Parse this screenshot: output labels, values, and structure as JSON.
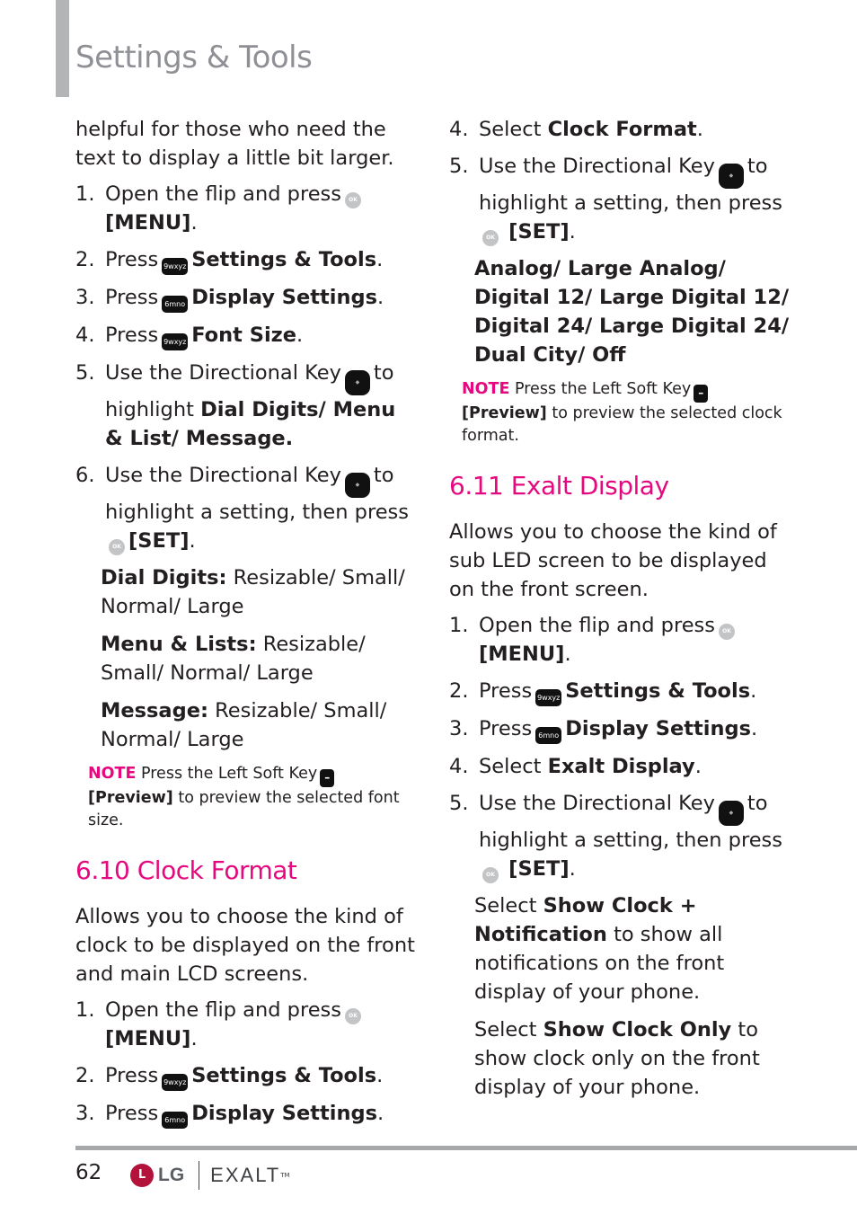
{
  "header": {
    "title": "Settings & Tools"
  },
  "left_column": {
    "intro": "helpful for those who need the text to display a little bit larger.",
    "steps": [
      {
        "num": "1.",
        "pre": "Open the flip and press",
        "icon": "ok-key",
        "icon_text": "OK",
        "bold": "[MENU]",
        "post": "."
      },
      {
        "num": "2.",
        "pre": "Press",
        "icon": "key-9",
        "icon_text": "9wxyz",
        "bold": "Settings & Tools",
        "post": "."
      },
      {
        "num": "3.",
        "pre": "Press",
        "icon": "key-6",
        "icon_text": "6mno",
        "bold": "Display Settings",
        "post": "."
      },
      {
        "num": "4.",
        "pre": "Press",
        "icon": "key-9",
        "icon_text": "9wxyz",
        "bold": "Font Size",
        "post": "."
      },
      {
        "num": "5.",
        "pre": "Use the Directional Key",
        "icon": "directional-key",
        "mid": "to highlight",
        "bold": "Dial Digits/ Menu & List/ Message."
      },
      {
        "num": "6.",
        "pre": "Use the Directional Key",
        "icon": "directional-key",
        "mid": "to highlight a setting, then press",
        "icon2_text": "OK",
        "bold": "[SET]",
        "post": "."
      }
    ],
    "options": [
      {
        "label": "Dial Digits:",
        "values": "Resizable/ Small/ Normal/ Large"
      },
      {
        "label": "Menu & Lists:",
        "values": "Resizable/ Small/ Normal/ Large"
      },
      {
        "label": "Message:",
        "values": "Resizable/ Small/ Normal/ Large"
      }
    ],
    "note": {
      "tag": "NOTE",
      "text1": "Press the Left Soft Key",
      "bold": "[Preview]",
      "text2": "to preview the selected font size."
    },
    "section": {
      "title": "6.10 Clock Format",
      "intro": "Allows you to choose the kind of clock to be displayed on the front and main LCD screens.",
      "steps": [
        {
          "num": "1.",
          "pre": "Open the flip and press",
          "icon_text": "OK",
          "bold": "[MENU]",
          "post": "."
        },
        {
          "num": "2.",
          "pre": "Press",
          "icon_text": "9wxyz",
          "bold": "Settings & Tools",
          "post": "."
        },
        {
          "num": "3.",
          "pre": "Press",
          "icon_text": "6mno",
          "bold": "Display Settings",
          "post": "."
        }
      ]
    }
  },
  "right_column": {
    "steps": [
      {
        "num": "4.",
        "pre": "Select",
        "bold": "Clock Format",
        "post": "."
      },
      {
        "num": "5.",
        "pre": "Use the Directional Key",
        "mid": "to highlight a setting, then press",
        "icon2_text": "OK",
        "bold": "[SET]",
        "post": "."
      }
    ],
    "options_text": "Analog/ Large Analog/ Digital 12/ Large Digital 12/ Digital 24/ Large Digital 24/ Dual City/ Off",
    "note": {
      "tag": "NOTE",
      "text1": "Press the Left Soft Key",
      "bold": "[Preview]",
      "text2": "to preview the selected clock format."
    },
    "section": {
      "title": "6.11 Exalt Display",
      "intro": "Allows you to choose the kind of sub LED screen to be displayed on the front screen.",
      "steps": [
        {
          "num": "1.",
          "pre": "Open the flip and press",
          "icon_text": "OK",
          "bold": "[MENU]",
          "post": "."
        },
        {
          "num": "2.",
          "pre": "Press",
          "icon_text": "9wxyz",
          "bold": "Settings & Tools",
          "post": "."
        },
        {
          "num": "3.",
          "pre": "Press",
          "icon_text": "6mno",
          "bold": "Display Settings",
          "post": "."
        },
        {
          "num": "4.",
          "pre": "Select",
          "bold": "Exalt Display",
          "post": "."
        },
        {
          "num": "5.",
          "pre": "Use the Directional Key",
          "mid": "to highlight a setting, then press",
          "icon2_text": "OK",
          "bold": "[SET]",
          "post": "."
        }
      ],
      "details": [
        {
          "pre": "Select",
          "bold": "Show Clock + Notification",
          "post": "to show all notifications on the front display of your phone."
        },
        {
          "pre": "Select",
          "bold": "Show Clock Only",
          "post": "to show clock only on the front display of your phone."
        }
      ]
    }
  },
  "footer": {
    "page_number": "62",
    "brand": "LG",
    "brand_mark": "L",
    "product": "EXALT",
    "trademark": "TM"
  }
}
